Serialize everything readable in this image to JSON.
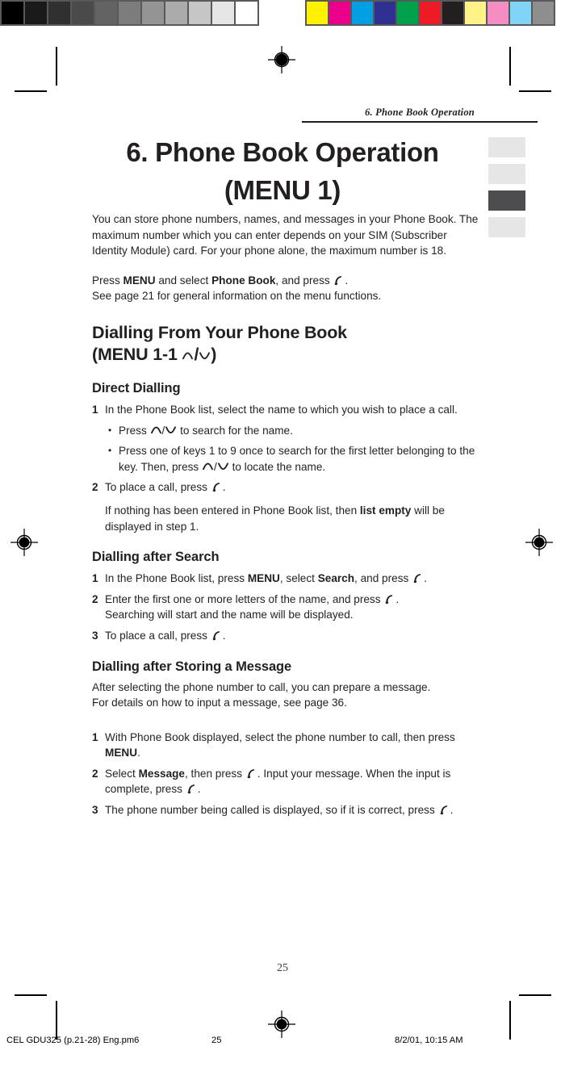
{
  "calibration": {
    "grayscale": [
      "#000000",
      "#1a1a1a",
      "#303030",
      "#4a4a4a",
      "#636363",
      "#7c7c7c",
      "#949494",
      "#ababab",
      "#c6c6c6",
      "#e6e6e6",
      "#ffffff"
    ],
    "colors": [
      "#fff200",
      "#ec0089",
      "#00a0e3",
      "#2e3192",
      "#00a14b",
      "#ed1c24",
      "#231f20",
      "#fff387",
      "#f68dc2",
      "#7fd4f7",
      "#8e8e8e"
    ]
  },
  "header": {
    "running_head": "6. Phone Book Operation"
  },
  "tabs": [
    {
      "name": "tab-1",
      "active": false
    },
    {
      "name": "tab-2",
      "active": false
    },
    {
      "name": "tab-3",
      "active": true
    },
    {
      "name": "tab-4",
      "active": false
    }
  ],
  "title": "6. Phone Book Operation (MENU 1)",
  "intro": {
    "paragraph": "You can store phone numbers, names, and messages in your Phone Book. The maximum number which you can enter depends on your SIM (Subscriber Identity Module) card. For your phone alone, the maximum number is 18.",
    "press_line_pre": "Press ",
    "press_line_menu": "MENU",
    "press_line_mid": " and select ",
    "press_line_item": "Phone Book",
    "press_line_post": ", and press ",
    "press_line_end": ".",
    "see_page_line": "See page 21 for general information on the menu functions."
  },
  "section_dialling": {
    "heading_line1": "Dialling From Your Phone Book",
    "heading_line2_pre": "(MENU 1-1 ",
    "heading_line2_sep": "/",
    "heading_line2_post": ")",
    "direct": {
      "heading": "Direct Dialling",
      "step1_num": "1",
      "step1_text": "In the Phone Book list, select the name to which you wish to place a call.",
      "bullet1_pre": "Press ",
      "bullet1_sep": "/",
      "bullet1_post": " to search for the name.",
      "bullet2_pre": "Press one of keys 1 to 9 once to search for the first letter belonging to the key.  Then, press ",
      "bullet2_sep": "/",
      "bullet2_post": " to locate the name.",
      "step2_num": "2",
      "step2_pre": "To place a call, press ",
      "step2_post": ".",
      "note_pre": "If nothing has been entered in Phone Book list, then ",
      "note_bold": "list empty",
      "note_post": " will be displayed in step 1."
    },
    "after_search": {
      "heading": "Dialling after Search",
      "step1_num": "1",
      "step1_pre": "In the Phone Book list, press ",
      "step1_b1": "MENU",
      "step1_mid": ", select ",
      "step1_b2": "Search",
      "step1_post": ", and press ",
      "step1_end": ".",
      "step2_num": "2",
      "step2_pre": "Enter the first one or more letters of the name, and press ",
      "step2_post": ".",
      "step2_line2": "Searching will start and the name will be displayed.",
      "step3_num": "3",
      "step3_pre": "To place a call, press ",
      "step3_post": "."
    },
    "after_storing": {
      "heading": "Dialling after Storing a Message",
      "intro_line1": "After selecting the phone number to call, you can prepare a message.",
      "intro_line2": "For details on how to input a message, see page 36.",
      "step1_num": "1",
      "step1_pre": "With Phone Book displayed, select the phone number to call, then press ",
      "step1_b": "MENU",
      "step1_post": ".",
      "step2_num": "2",
      "step2_pre": "Select ",
      "step2_b": "Message",
      "step2_mid": ", then press ",
      "step2_mid2": ".  Input your message.  When the input is complete, press ",
      "step2_post": ".",
      "step3_num": "3",
      "step3_pre": "The phone number being called is displayed, so if it is correct, press ",
      "step3_post": "."
    }
  },
  "page_number": "25",
  "footer": {
    "file": "CEL GDU325 (p.21-28) Eng.pm6",
    "page": "25",
    "timestamp": "8/2/01, 10:15 AM"
  }
}
